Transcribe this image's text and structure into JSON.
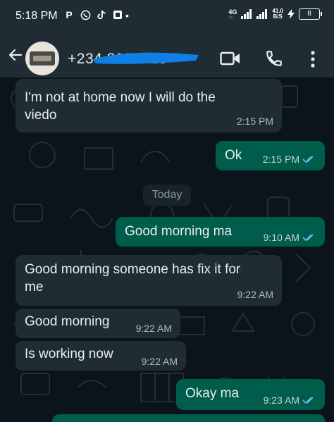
{
  "status_bar": {
    "time": "5:18 PM",
    "app_icons": [
      "P",
      "whatsapp-icon",
      "tiktok-icon",
      "office-icon"
    ],
    "dot": "•",
    "network_type": "4G",
    "network_sub": "↑↓",
    "speed_value": "41.0",
    "speed_unit": "B/S",
    "battery": "8"
  },
  "header": {
    "contact_name": "+234 813 5 15",
    "icons": [
      "back-arrow-icon",
      "video-call-icon",
      "voice-call-icon",
      "more-vert-icon"
    ]
  },
  "messages": [
    {
      "direction": "in",
      "text": "I'm not at home now I will do the\nviedo",
      "time": "2:15 PM"
    },
    {
      "direction": "out",
      "text": "Ok",
      "time": "2:15 PM",
      "read": true
    },
    {
      "direction": "out",
      "text": "Good morning ma",
      "time": "9:10 AM",
      "read": true
    },
    {
      "direction": "in",
      "text": "Good morning someone has fix it for\nme",
      "time": "9:22 AM"
    },
    {
      "direction": "in",
      "text": "Good morning",
      "time": "9:22 AM"
    },
    {
      "direction": "in",
      "text": "Is working now",
      "time": "9:22 AM"
    },
    {
      "direction": "out",
      "text": "Okay ma",
      "time": "9:23 AM",
      "read": true
    }
  ],
  "date_divider": "Today",
  "colors": {
    "background": "#0b141a",
    "incoming_bubble": "#1f2c34",
    "outgoing_bubble": "#005c4b",
    "read_ticks": "#53bdeb",
    "redaction": "#0f7fe6"
  }
}
